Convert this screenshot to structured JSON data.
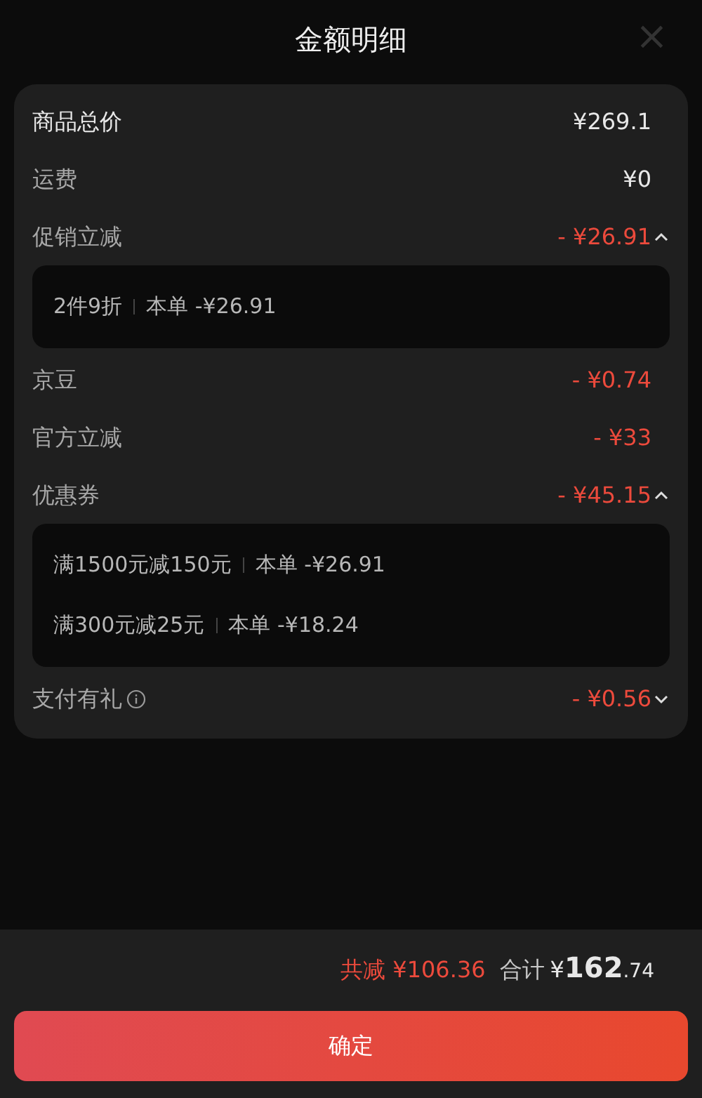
{
  "header": {
    "title": "金额明细",
    "close": "×"
  },
  "rows": [
    {
      "label": "商品总价",
      "amount": "¥269.1",
      "kind": "total"
    },
    {
      "label": "运费",
      "amount": "¥0",
      "kind": "plain"
    },
    {
      "label": "促销立减",
      "amount": "- ¥26.91",
      "kind": "discount",
      "expanded": true,
      "details": [
        {
          "name": "2件9折",
          "amount": "本单 -¥26.91"
        }
      ]
    },
    {
      "label": "京豆",
      "amount": "- ¥0.74",
      "kind": "discount"
    },
    {
      "label": "官方立减",
      "amount": "- ¥33",
      "kind": "discount"
    },
    {
      "label": "优惠券",
      "amount": "- ¥45.15",
      "kind": "discount",
      "expanded": true,
      "details": [
        {
          "name": "满1500元减150元",
          "amount": "本单 -¥26.91"
        },
        {
          "name": "满300元减25元",
          "amount": "本单 -¥18.24"
        }
      ]
    },
    {
      "label": "支付有礼",
      "amount": "- ¥0.56",
      "kind": "discount",
      "info": true,
      "expanded": false
    }
  ],
  "footer": {
    "saved": "共减 ¥106.36",
    "total_label": "合计",
    "currency": "¥",
    "total_integer": "162",
    "total_decimal": ".74",
    "confirm": "确定"
  }
}
